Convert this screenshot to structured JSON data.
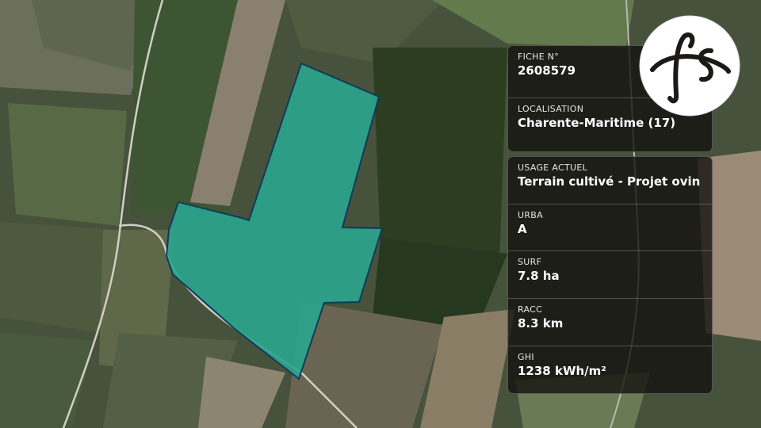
{
  "map": {
    "parcel_fill": "#2aa58e",
    "parcel_stroke": "#123a5a"
  },
  "card_top": {
    "fields": [
      {
        "label": "FICHE N°",
        "value": "2608579"
      },
      {
        "label": "LOCALISATION",
        "value": "Charente-Maritime (17)"
      }
    ]
  },
  "card_bottom": {
    "fields": [
      {
        "label": "USAGE ACTUEL",
        "value": "Terrain cultivé - Projet ovin"
      },
      {
        "label": "URBA",
        "value": "A"
      },
      {
        "label": "SURF",
        "value": "7.8 ha"
      },
      {
        "label": "RACC",
        "value": "8.3 km"
      },
      {
        "label": "GHI",
        "value": "1238 kWh/m²"
      }
    ]
  },
  "logo": {
    "icon": "fs-logo-icon",
    "text": "fs"
  }
}
